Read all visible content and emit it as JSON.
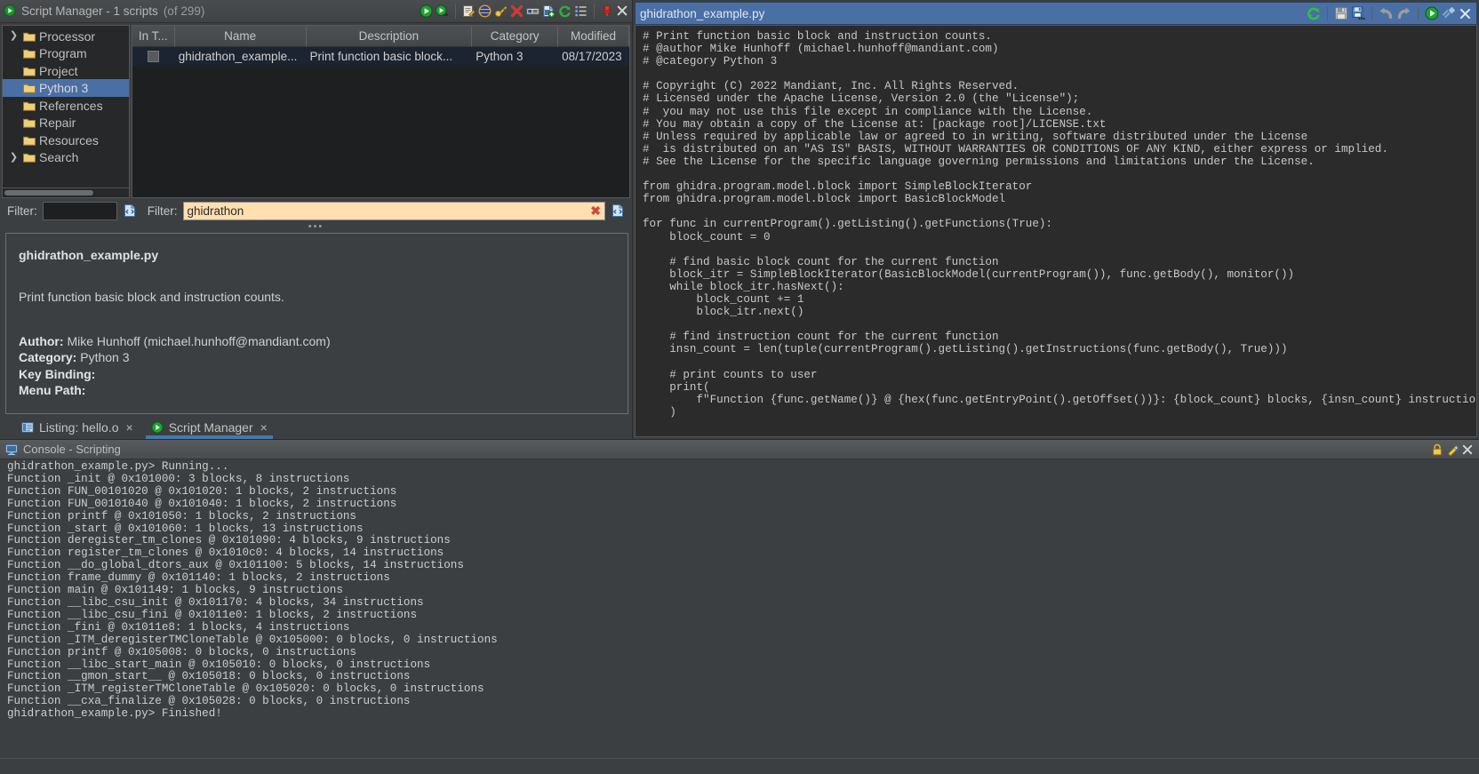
{
  "script_manager": {
    "title": "Script Manager - 1 scripts",
    "subtitle": "(of 299)",
    "title_icon": "run-script-icon",
    "toolbar": [
      {
        "name": "run-script-icon",
        "label": "Run Script"
      },
      {
        "name": "run-last-script-icon",
        "label": "Run Last Script"
      },
      {
        "name": "edit-script-icon",
        "label": "Edit Script"
      },
      {
        "name": "edit-with-basic-editor-icon",
        "label": "Edit with Basic Editor"
      },
      {
        "name": "key-binding-icon",
        "label": "Assign Key Binding"
      },
      {
        "name": "delete-script-icon",
        "label": "Delete Script"
      },
      {
        "name": "rename-script-icon",
        "label": "Rename Script"
      },
      {
        "name": "new-script-icon",
        "label": "Create New Script"
      },
      {
        "name": "refresh-icon",
        "label": "Refresh Script List"
      },
      {
        "name": "script-directories-icon",
        "label": "Script Directories"
      },
      {
        "name": "pin-window-icon",
        "label": "Pin"
      },
      {
        "name": "close-window-icon",
        "label": "Close"
      }
    ],
    "tree": {
      "items": [
        {
          "label": "Processor",
          "expandable": true,
          "selected": false
        },
        {
          "label": "Program",
          "expandable": false,
          "selected": false
        },
        {
          "label": "Project",
          "expandable": false,
          "selected": false
        },
        {
          "label": "Python 3",
          "expandable": false,
          "selected": true
        },
        {
          "label": "References",
          "expandable": false,
          "selected": false
        },
        {
          "label": "Repair",
          "expandable": false,
          "selected": false
        },
        {
          "label": "Resources",
          "expandable": false,
          "selected": false
        },
        {
          "label": "Search",
          "expandable": true,
          "selected": false
        }
      ]
    },
    "table": {
      "columns": [
        "In T...",
        "Name",
        "Description",
        "Category",
        "Modified"
      ],
      "rows": [
        {
          "in_tool": false,
          "name": "ghidrathon_example...",
          "description": "Print function basic block...",
          "category": "Python 3",
          "modified": "08/17/2023"
        }
      ]
    },
    "tree_filter": {
      "label": "Filter:",
      "value": "",
      "placeholder": "",
      "options_icon": "filter-options-icon"
    },
    "table_filter": {
      "label": "Filter:",
      "value": "ghidrathon",
      "placeholder": "",
      "clear_icon": "clear-filter-icon",
      "options_icon": "filter-options-icon"
    },
    "description": {
      "script_name": "ghidrathon_example.py",
      "summary": "Print function basic block and instruction counts.",
      "author_label": "Author:",
      "author_value": "Mike Hunhoff (michael.hunhoff@mandiant.com)",
      "category_label": "Category:",
      "category_value": "Python 3",
      "key_binding_label": "Key Binding:",
      "key_binding_value": "",
      "menu_path_label": "Menu Path:",
      "menu_path_value": ""
    },
    "window_tabs": [
      {
        "label": "Listing:  hello.o",
        "icon": "listing-icon",
        "active": false,
        "close": "×"
      },
      {
        "label": "Script Manager",
        "icon": "run-script-icon",
        "active": true,
        "close": "×"
      }
    ]
  },
  "editor": {
    "title": "ghidrathon_example.py",
    "toolbar": [
      {
        "name": "refresh-icon",
        "label": "Refresh"
      },
      {
        "name": "save-icon",
        "label": "Save"
      },
      {
        "name": "save-as-icon",
        "label": "Save As"
      },
      {
        "name": "undo-icon",
        "label": "Undo"
      },
      {
        "name": "redo-icon",
        "label": "Redo"
      },
      {
        "name": "run-script-icon",
        "label": "Run Script"
      },
      {
        "name": "key-binding-icon",
        "label": "Key Binding"
      },
      {
        "name": "close-icon",
        "label": "Close"
      }
    ],
    "code": "# Print function basic block and instruction counts.\n# @author Mike Hunhoff (michael.hunhoff@mandiant.com)\n# @category Python 3\n\n# Copyright (C) 2022 Mandiant, Inc. All Rights Reserved.\n# Licensed under the Apache License, Version 2.0 (the \"License\");\n#  you may not use this file except in compliance with the License.\n# You may obtain a copy of the License at: [package root]/LICENSE.txt\n# Unless required by applicable law or agreed to in writing, software distributed under the License\n#  is distributed on an \"AS IS\" BASIS, WITHOUT WARRANTIES OR CONDITIONS OF ANY KIND, either express or implied.\n# See the License for the specific language governing permissions and limitations under the License.\n\nfrom ghidra.program.model.block import SimpleBlockIterator\nfrom ghidra.program.model.block import BasicBlockModel\n\nfor func in currentProgram().getListing().getFunctions(True):\n    block_count = 0\n\n    # find basic block count for the current function\n    block_itr = SimpleBlockIterator(BasicBlockModel(currentProgram()), func.getBody(), monitor())\n    while block_itr.hasNext():\n        block_count += 1\n        block_itr.next()\n\n    # find instruction count for the current function\n    insn_count = len(tuple(currentProgram().getListing().getInstructions(func.getBody(), True)))\n\n    # print counts to user\n    print(\n        f\"Function {func.getName()} @ {hex(func.getEntryPoint().getOffset())}: {block_count} blocks, {insn_count} instructions\"\n    )"
  },
  "console": {
    "title": "Console - Scripting",
    "title_icon": "console-icon",
    "toolbar": [
      {
        "name": "lock-icon",
        "label": "Lock Scroll"
      },
      {
        "name": "clear-console-icon",
        "label": "Clear Console"
      },
      {
        "name": "close-icon",
        "label": "Close"
      }
    ],
    "output": "ghidrathon_example.py> Running...\nFunction _init @ 0x101000: 3 blocks, 8 instructions\nFunction FUN_00101020 @ 0x101020: 1 blocks, 2 instructions\nFunction FUN_00101040 @ 0x101040: 1 blocks, 2 instructions\nFunction printf @ 0x101050: 1 blocks, 2 instructions\nFunction _start @ 0x101060: 1 blocks, 13 instructions\nFunction deregister_tm_clones @ 0x101090: 4 blocks, 9 instructions\nFunction register_tm_clones @ 0x1010c0: 4 blocks, 14 instructions\nFunction __do_global_dtors_aux @ 0x101100: 5 blocks, 14 instructions\nFunction frame_dummy @ 0x101140: 1 blocks, 2 instructions\nFunction main @ 0x101149: 1 blocks, 9 instructions\nFunction __libc_csu_init @ 0x101170: 4 blocks, 34 instructions\nFunction __libc_csu_fini @ 0x1011e0: 1 blocks, 2 instructions\nFunction _fini @ 0x1011e8: 1 blocks, 4 instructions\nFunction _ITM_deregisterTMCloneTable @ 0x105000: 0 blocks, 0 instructions\nFunction printf @ 0x105008: 0 blocks, 0 instructions\nFunction __libc_start_main @ 0x105010: 0 blocks, 0 instructions\nFunction __gmon_start__ @ 0x105018: 0 blocks, 0 instructions\nFunction _ITM_registerTMCloneTable @ 0x105020: 0 blocks, 0 instructions\nFunction __cxa_finalize @ 0x105028: 0 blocks, 0 instructions\nghidrathon_example.py> Finished!"
  },
  "colors": {
    "selection_blue": "#4a6fa5",
    "filter_amber": "#ffdfb0",
    "panel_bg": "#3c3f41",
    "code_bg": "#2b2b2b",
    "tab_underline": "#4a77ab"
  }
}
